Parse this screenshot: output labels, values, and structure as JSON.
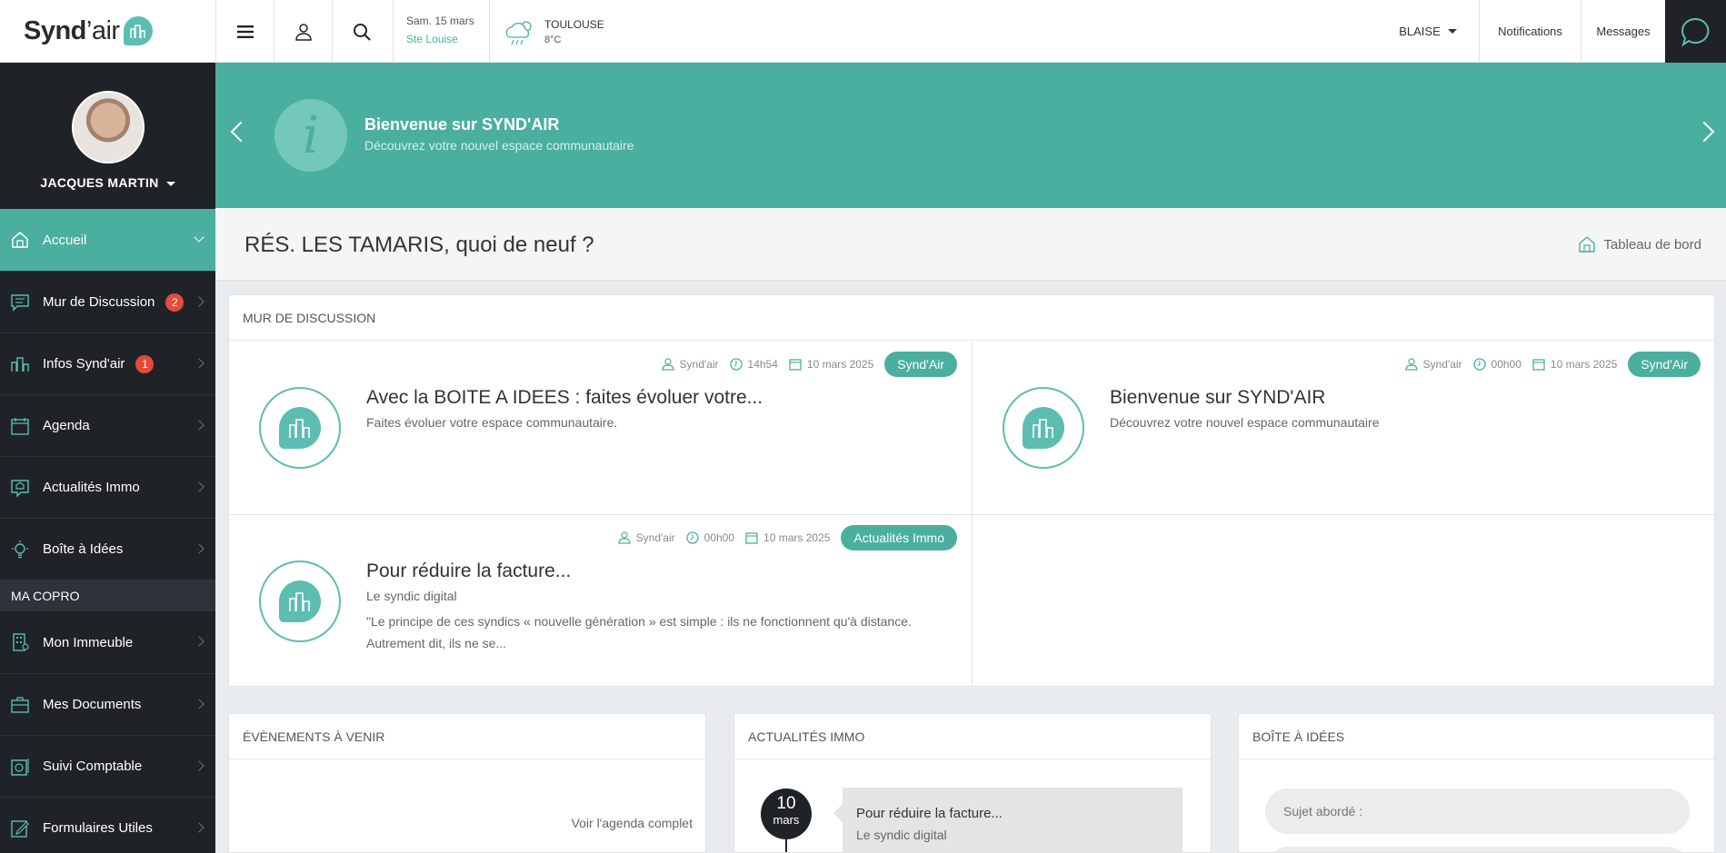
{
  "brand": {
    "name_bold": "Synd",
    "name_light": "’air"
  },
  "header": {
    "date": "Sam. 15 mars",
    "saint": "Ste Louise",
    "weather_city": "TOULOUSE",
    "weather_temp": "8°C",
    "user": "BLAISE",
    "notifications": "Notifications",
    "messages": "Messages",
    "icons": [
      "menu-icon",
      "user-icon",
      "search-icon",
      "cloud-rain-icon",
      "chat-bubble-icon"
    ]
  },
  "sidebar": {
    "user_name": "JACQUES MARTIN",
    "items": [
      {
        "label": "Accueil",
        "icon": "home-icon",
        "active": true
      },
      {
        "label": "Mur de Discussion",
        "icon": "discussion-icon",
        "badge": "2"
      },
      {
        "label": "Infos Synd'air",
        "icon": "building-icon",
        "badge": "1"
      },
      {
        "label": "Agenda",
        "icon": "calendar-icon"
      },
      {
        "label": "Actualités Immo",
        "icon": "news-icon"
      },
      {
        "label": "Boîte à Idées",
        "icon": "lightbulb-icon"
      }
    ],
    "section": "MA COPRO",
    "items2": [
      {
        "label": "Mon Immeuble",
        "icon": "apartment-icon"
      },
      {
        "label": "Mes Documents",
        "icon": "briefcase-icon"
      },
      {
        "label": "Suivi Comptable",
        "icon": "accounting-icon"
      },
      {
        "label": "Formulaires Utiles",
        "icon": "form-icon"
      }
    ]
  },
  "banner": {
    "title": "Bienvenue sur SYND'AIR",
    "subtitle": "Découvrez votre nouvel espace communautaire",
    "icon": "i"
  },
  "page": {
    "title": "RÉS. LES TAMARIS, quoi de neuf ?",
    "dashboard_link": "Tableau de bord"
  },
  "discussion": {
    "header": "MUR DE DISCUSSION",
    "posts": [
      {
        "author": "Synd'air",
        "time": "14h54",
        "date": "10 mars 2025",
        "tag": "Synd'Air",
        "title": "Avec la BOITE A IDEES : faites évoluer votre...",
        "subtitle": "Faites évoluer votre espace communautaire.",
        "excerpt": ""
      },
      {
        "author": "Synd'air",
        "time": "00h00",
        "date": "10 mars 2025",
        "tag": "Synd'Air",
        "title": "Bienvenue sur SYND'AIR",
        "subtitle": "Découvrez votre nouvel espace communautaire",
        "excerpt": ""
      },
      {
        "author": "Synd'air",
        "time": "00h00",
        "date": "10 mars 2025",
        "tag": "Actualités Immo",
        "title": "Pour réduire la facture...",
        "subtitle": "Le syndic digital",
        "excerpt": "\"Le principe de ces syndics « nouvelle génération » est simple : ils ne fonctionnent qu'à distance. Autrement dit, ils ne se..."
      }
    ]
  },
  "events": {
    "header": "ÉVÈNEMENTS À VENIR",
    "link": "Voir l'agenda complet"
  },
  "immo": {
    "header": "ACTUALITÉS IMMO",
    "day": "10",
    "month": "mars",
    "title": "Pour réduire la facture...",
    "subtitle": "Le syndic digital"
  },
  "ideas": {
    "header": "BOÎTE À IDÉES",
    "placeholder": "Sujet abordé :"
  },
  "colors": {
    "accent": "#4aaf9f",
    "sidebar": "#1f2328",
    "badge": "#e64a3b"
  }
}
